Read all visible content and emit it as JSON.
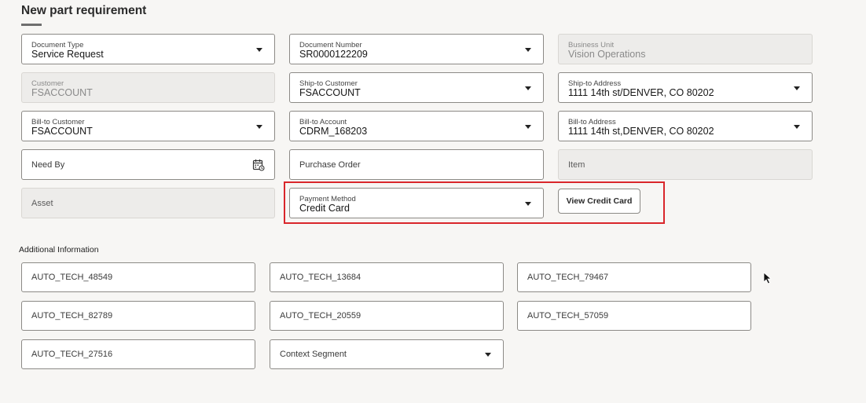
{
  "page": {
    "title": "New part requirement"
  },
  "form": {
    "document_type": {
      "label": "Document Type",
      "value": "Service Request"
    },
    "document_number": {
      "label": "Document Number",
      "value": "SR0000122209"
    },
    "business_unit": {
      "label": "Business Unit",
      "value": "Vision Operations"
    },
    "customer": {
      "label": "Customer",
      "value": "FSACCOUNT"
    },
    "ship_to_customer": {
      "label": "Ship-to Customer",
      "value": "FSACCOUNT"
    },
    "ship_to_address": {
      "label": "Ship-to Address",
      "value": "1111 14th st/DENVER, CO 80202"
    },
    "bill_to_customer": {
      "label": "Bill-to Customer",
      "value": "FSACCOUNT"
    },
    "bill_to_account": {
      "label": "Bill-to Account",
      "value": "CDRM_168203"
    },
    "bill_to_address": {
      "label": "Bill-to Address",
      "value": "1111 14th st,DENVER, CO 80202"
    },
    "need_by": {
      "placeholder": "Need By"
    },
    "purchase_order": {
      "placeholder": "Purchase Order"
    },
    "item": {
      "placeholder": "Item"
    },
    "asset": {
      "placeholder": "Asset"
    },
    "payment_method": {
      "label": "Payment Method",
      "value": "Credit Card"
    },
    "view_credit_card_label": "View Credit Card"
  },
  "additional_information": {
    "label": "Additional Information",
    "fields": [
      "AUTO_TECH_48549",
      "AUTO_TECH_13684",
      "AUTO_TECH_79467",
      "AUTO_TECH_82789",
      "AUTO_TECH_20559",
      "AUTO_TECH_57059",
      "AUTO_TECH_27516"
    ],
    "context_segment": {
      "placeholder": "Context Segment"
    }
  },
  "colors": {
    "highlight": "#d9262b",
    "background": "#f7f6f4",
    "readonly_fill": "#edecea"
  }
}
